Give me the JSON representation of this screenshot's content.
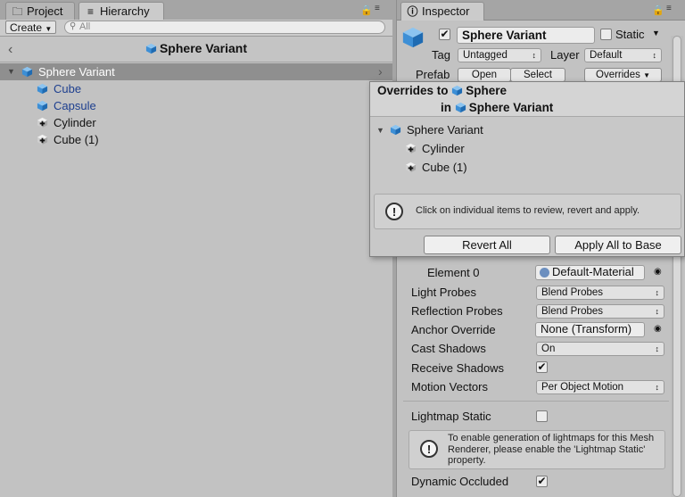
{
  "tabs": {
    "project": "Project",
    "hierarchy": "Hierarchy",
    "inspector": "Inspector"
  },
  "hierarchy": {
    "create_label": "Create",
    "search_placeholder": "All",
    "breadcrumb_title": "Sphere Variant",
    "items": [
      {
        "label": "Sphere Variant"
      },
      {
        "label": "Cube"
      },
      {
        "label": "Capsule"
      },
      {
        "label": "Cylinder"
      },
      {
        "label": "Cube (1)"
      }
    ]
  },
  "inspector": {
    "object_name": "Sphere Variant",
    "static_label": "Static",
    "tag_label": "Tag",
    "tag_value": "Untagged",
    "layer_label": "Layer",
    "layer_value": "Default",
    "prefab_label": "Prefab",
    "open_label": "Open",
    "select_label": "Select",
    "overrides_label": "Overrides",
    "element0_label": "Element 0",
    "element0_value": "Default-Material",
    "light_probes_label": "Light Probes",
    "light_probes_value": "Blend Probes",
    "reflection_probes_label": "Reflection Probes",
    "reflection_probes_value": "Blend Probes",
    "anchor_override_label": "Anchor Override",
    "anchor_override_value": "None (Transform)",
    "cast_shadows_label": "Cast Shadows",
    "cast_shadows_value": "On",
    "receive_shadows_label": "Receive Shadows",
    "motion_vectors_label": "Motion Vectors",
    "motion_vectors_value": "Per Object Motion",
    "lightmap_static_label": "Lightmap Static",
    "lightmap_info": "To enable generation of lightmaps for this Mesh Renderer, please enable the 'Lightmap Static' property.",
    "dynamic_occluded_label": "Dynamic Occluded"
  },
  "popup": {
    "overrides_to": "Overrides to",
    "target": "Sphere",
    "in_label": "in",
    "instance": "Sphere Variant",
    "tree": [
      {
        "label": "Sphere Variant"
      },
      {
        "label": "Cylinder"
      },
      {
        "label": "Cube (1)"
      }
    ],
    "info_text": "Click on individual items to review, revert and apply.",
    "revert_all": "Revert All",
    "apply_all": "Apply All to Base"
  },
  "colors": {
    "selection": "#8f8f8f",
    "prefab_blue": "#1d3f8f",
    "cube_blue": "#3d8fd6"
  }
}
